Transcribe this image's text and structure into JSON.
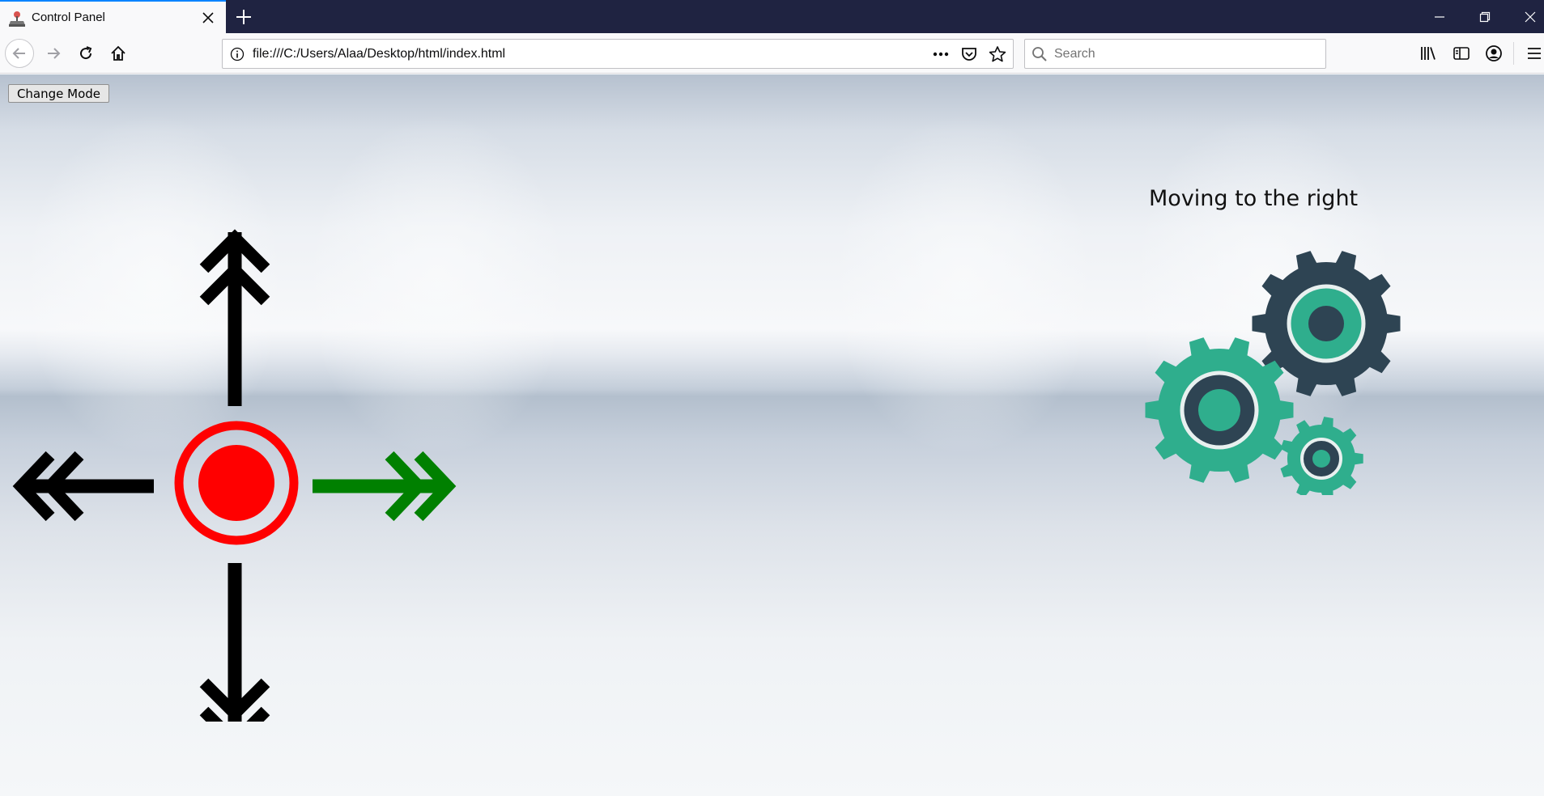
{
  "browser": {
    "tab": {
      "title": "Control Panel",
      "favicon": "joystick-icon"
    },
    "url": "file:///C:/Users/Alaa/Desktop/html/index.html",
    "search_placeholder": "Search",
    "icons": [
      "back-arrow-icon",
      "forward-arrow-icon",
      "reload-icon",
      "home-icon",
      "page-info-icon",
      "more-dots-icon",
      "pocket-icon",
      "bookmark-star-icon",
      "search-icon",
      "library-icon",
      "sidebar-icon",
      "account-icon",
      "hamburger-menu-icon"
    ]
  },
  "page": {
    "change_mode_label": "Change Mode",
    "status_text": "Moving to the right",
    "controls": {
      "active_direction": "right",
      "colors": {
        "active": "#008000",
        "inactive": "#000000",
        "stop": "#ff0000"
      }
    },
    "gear_colors": {
      "teal": "#2fae8d",
      "dark": "#2e4453",
      "ring_light": "#e8f0ef"
    }
  }
}
